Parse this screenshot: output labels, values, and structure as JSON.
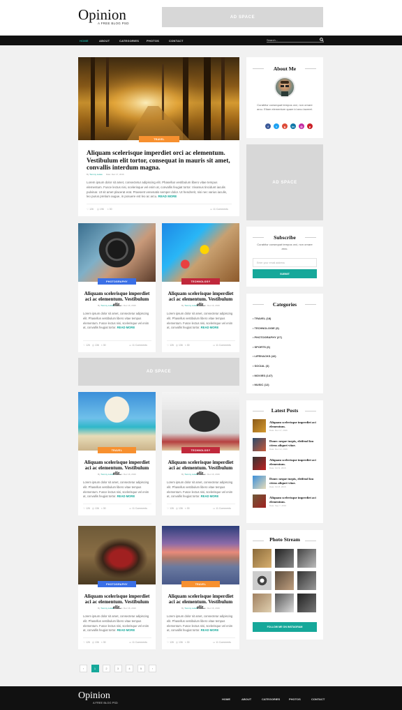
{
  "header": {
    "logo": "Opinion",
    "tagline": "A FREE BLOG PSD",
    "ad": "AD SPACE"
  },
  "nav": {
    "items": [
      "HOME",
      "ABOUT",
      "CATEGORIES",
      "PHOTOS",
      "CONTACT"
    ],
    "search_placeholder": "Search..."
  },
  "featured": {
    "badge": "TRAVEL",
    "title": "Aliquam scelerisque imperdiet orci ac elementum. Vestibulum elit tortor, consequat in mauris sit amet, convallis interdum magna.",
    "author": "Tommy Lukas",
    "date": "Date: Dec 17, 2016",
    "excerpt": "Lorem ipsum dolor sit amet, consectetur adipiscing elit. Phasellus vestibulum libero vitae tempus elementum. Fusce lectus nisi, scelerisque vel enim at, convallis feugiat tortor. Vivamus tincidunt iaculis pulvinar. Ut sit amet placerat erat. Praesent venenatis semper dolor. Ut hendrerit, nisi nec varius iaculis, leo purus pretium augue, in posuere est leo ac arcu.",
    "read_more": "READ MORE",
    "likes": "126",
    "views": "196",
    "shares": "30",
    "comments": "11 Comments"
  },
  "posts": [
    {
      "badge": "PHOTOGRAPHY",
      "color": "#3a6fe6",
      "title": "Aliquam scelerisque imperdiet aci ac elementum. Vestibulum elit.",
      "author": "Tommy Lukas",
      "date": "Date: Dec 16, 2016",
      "excerpt": "Lorem ipsum dolor sit amet, consectetur adipiscing elit. Phasellus vestibulum libero vitae tempus elementum. Fusce lectus nisi, scelerisque vel enim at, convallis feugiat tortor.",
      "read_more": "READ MORE",
      "likes": "126",
      "views": "136",
      "shares": "30",
      "comments": "11 Comments"
    },
    {
      "badge": "TECHNOLOGY",
      "color": "#c0283b",
      "title": "Aliquam scelerisque imperdiet aci ac elementum. Vestibulum elit.",
      "author": "Tommy Lukas",
      "date": "Date: Dec 16, 2016",
      "excerpt": "Lorem ipsum dolor sit amet, consectetur adipiscing elit. Phasellus vestibulum libero vitae tempus elementum. Fusce lectus nisi, scelerisque vel enim at, convallis feugiat tortor.",
      "read_more": "READ MORE",
      "likes": "126",
      "views": "136",
      "shares": "30",
      "comments": "11 Comments"
    },
    {
      "badge": "TRAVEL",
      "color": "#f7902f",
      "title": "Aliquam scelerisque imperdiet aci ac elementum. Vestibulum elit.",
      "author": "Tommy Lukas",
      "date": "Date: Dec 16, 2016",
      "excerpt": "Lorem ipsum dolor sit amet, consectetur adipiscing elit. Phasellus vestibulum libero vitae tempus elementum. Fusce lectus nisi, scelerisque vel enim at, convallis feugiat tortor.",
      "read_more": "READ MORE",
      "likes": "126",
      "views": "136",
      "shares": "30",
      "comments": "11 Comments"
    },
    {
      "badge": "TECHNOLOGY",
      "color": "#c0283b",
      "title": "Aliquam scelerisque imperdiet aci ac elementum. Vestibulum elit.",
      "author": "Tommy Lukas",
      "date": "Date: Dec 16, 2016",
      "excerpt": "Lorem ipsum dolor sit amet, consectetur adipiscing elit. Phasellus vestibulum libero vitae tempus elementum. Fusce lectus nisi, scelerisque vel enim at, convallis feugiat tortor.",
      "read_more": "READ MORE",
      "likes": "126",
      "views": "136",
      "shares": "30",
      "comments": "11 Comments"
    },
    {
      "badge": "PHOTOGRAPHY",
      "color": "#3a6fe6",
      "title": "Aliquam scelerisque imperdiet aci ac elementum. Vestibulum elit.",
      "author": "Tommy Lukas",
      "date": "Date: Dec 16, 2016",
      "excerpt": "Lorem ipsum dolor sit amet, consectetur adipiscing elit. Phasellus vestibulum libero vitae tempus elementum. Fusce lectus nisi, scelerisque vel enim at, convallis feugiat tortor.",
      "read_more": "READ MORE",
      "likes": "126",
      "views": "136",
      "shares": "30",
      "comments": "11 Comments"
    },
    {
      "badge": "TRAVEL",
      "color": "#f7902f",
      "title": "Aliquam scelerisque imperdiet aci ac elementum. Vestibulum elit.",
      "author": "Tommy Lukas",
      "date": "Date: Dec 16, 2016",
      "excerpt": "Lorem ipsum dolor sit amet, consectetur adipiscing elit. Phasellus vestibulum libero vitae tempus elementum. Fusce lectus nisi, scelerisque vel enim at, convallis feugiat tortor.",
      "read_more": "READ MORE",
      "likes": "126",
      "views": "136",
      "shares": "30",
      "comments": "11 Comments"
    }
  ],
  "mid_ad": "AD SPACE",
  "sidebar": {
    "about": {
      "title": "About Me",
      "text": "Curabitur consequat tempus orci, non ornare arcu. Etiam elementum quam id arcu laoreet."
    },
    "ad": "AD SPACE",
    "subscribe": {
      "title": "Subscribe",
      "text": "Curabitur consequat tempus orci, non ornare arcu.",
      "placeholder": "Enter your email address",
      "button": "SUBMIT"
    },
    "categories": {
      "title": "Categories",
      "items": [
        "TRAVEL (18)",
        "TECHNOLOGIE (9)",
        "PHOTOGRAPHY (27)",
        "SPORTS (6)",
        "LIFEHACKS (42)",
        "SOCIAL (3)",
        "MOVIES (147)",
        "MUSIC (12)"
      ]
    },
    "latest": {
      "title": "Latest Posts",
      "items": [
        {
          "title": "Aliquam scelerisque imperdiet aci elementum.",
          "date": "Date: Dec 17, 2016"
        },
        {
          "title": "Donec neque turpis, eleifend fau citrus aliquet vitae.",
          "date": "Date: Dec 12, 2016"
        },
        {
          "title": "Aliquam scelerisque imperdiet aci elementum.",
          "date": "Date: Oct 9, 2016"
        },
        {
          "title": "Donec neque turpis, eleifend fau citrus aliquet vitae.",
          "date": "Date: Oct 8, 2016"
        },
        {
          "title": "Aliquam scelerisque imperdiet aci elementum.",
          "date": "Date: Sep 7, 2016"
        }
      ]
    },
    "photostream": {
      "title": "Photo Stream",
      "button": "FOLLOW ME ON INSTAGRAM"
    }
  },
  "pagination": [
    "‹",
    "1",
    "2",
    "3",
    "4",
    "5",
    "›"
  ],
  "footer": {
    "logo": "Opinion",
    "tagline": "A FREE BLOG PSD",
    "items": [
      "HOME",
      "ABOUT",
      "CATEGORIES",
      "PHOTOS",
      "CONTACT"
    ]
  }
}
